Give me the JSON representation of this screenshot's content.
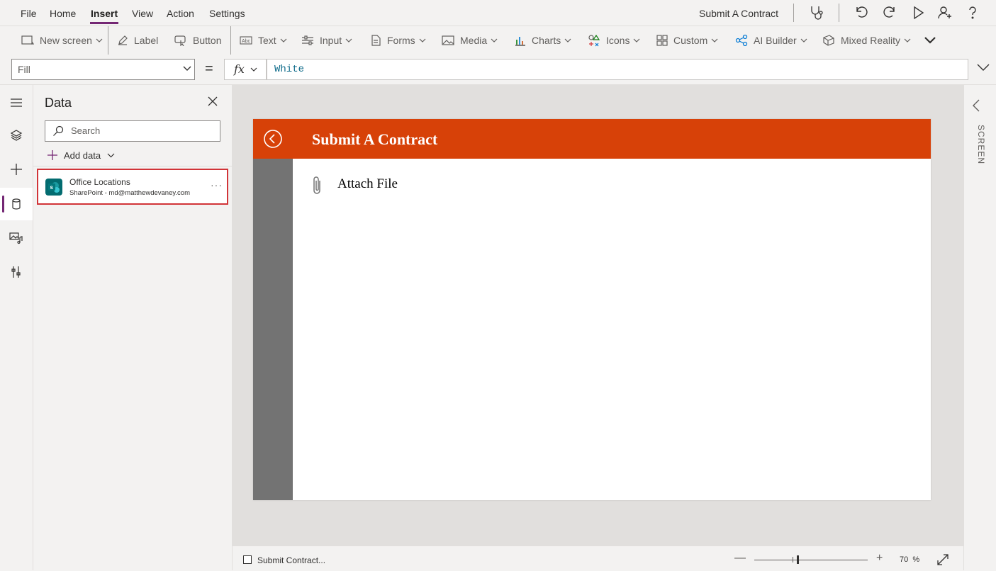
{
  "menu": {
    "items": [
      {
        "label": "File"
      },
      {
        "label": "Home"
      },
      {
        "label": "Insert"
      },
      {
        "label": "View"
      },
      {
        "label": "Action"
      },
      {
        "label": "Settings"
      }
    ],
    "active": "Insert",
    "app_title": "Submit A Contract"
  },
  "ribbon": {
    "new_screen": "New screen",
    "label": "Label",
    "button": "Button",
    "text": "Text",
    "input": "Input",
    "forms": "Forms",
    "media": "Media",
    "charts": "Charts",
    "icons": "Icons",
    "custom": "Custom",
    "ai_builder": "AI Builder",
    "mixed_reality": "Mixed Reality"
  },
  "formula": {
    "property": "Fill",
    "equals": "=",
    "fx": "fx",
    "value": "White"
  },
  "data_panel": {
    "title": "Data",
    "search_placeholder": "Search",
    "add_data": "Add data",
    "source": {
      "name": "Office Locations",
      "subtitle": "SharePoint - md@matthewdevaney.com",
      "more": "···"
    }
  },
  "canvas": {
    "title": "Submit A Contract",
    "attach_label": "Attach File",
    "colors": {
      "header": "#d74108",
      "sidebar": "#737373",
      "background": "#ffffff"
    }
  },
  "status_bar": {
    "screen_name": "Submit Contract...",
    "zoom_value": "70",
    "zoom_unit": "%"
  },
  "right_panel": {
    "label": "SCREEN"
  },
  "colors": {
    "accent": "#742774",
    "highlight": "#d13438",
    "formula_text": "#0e6b8a",
    "sharepoint": "#036c70"
  }
}
